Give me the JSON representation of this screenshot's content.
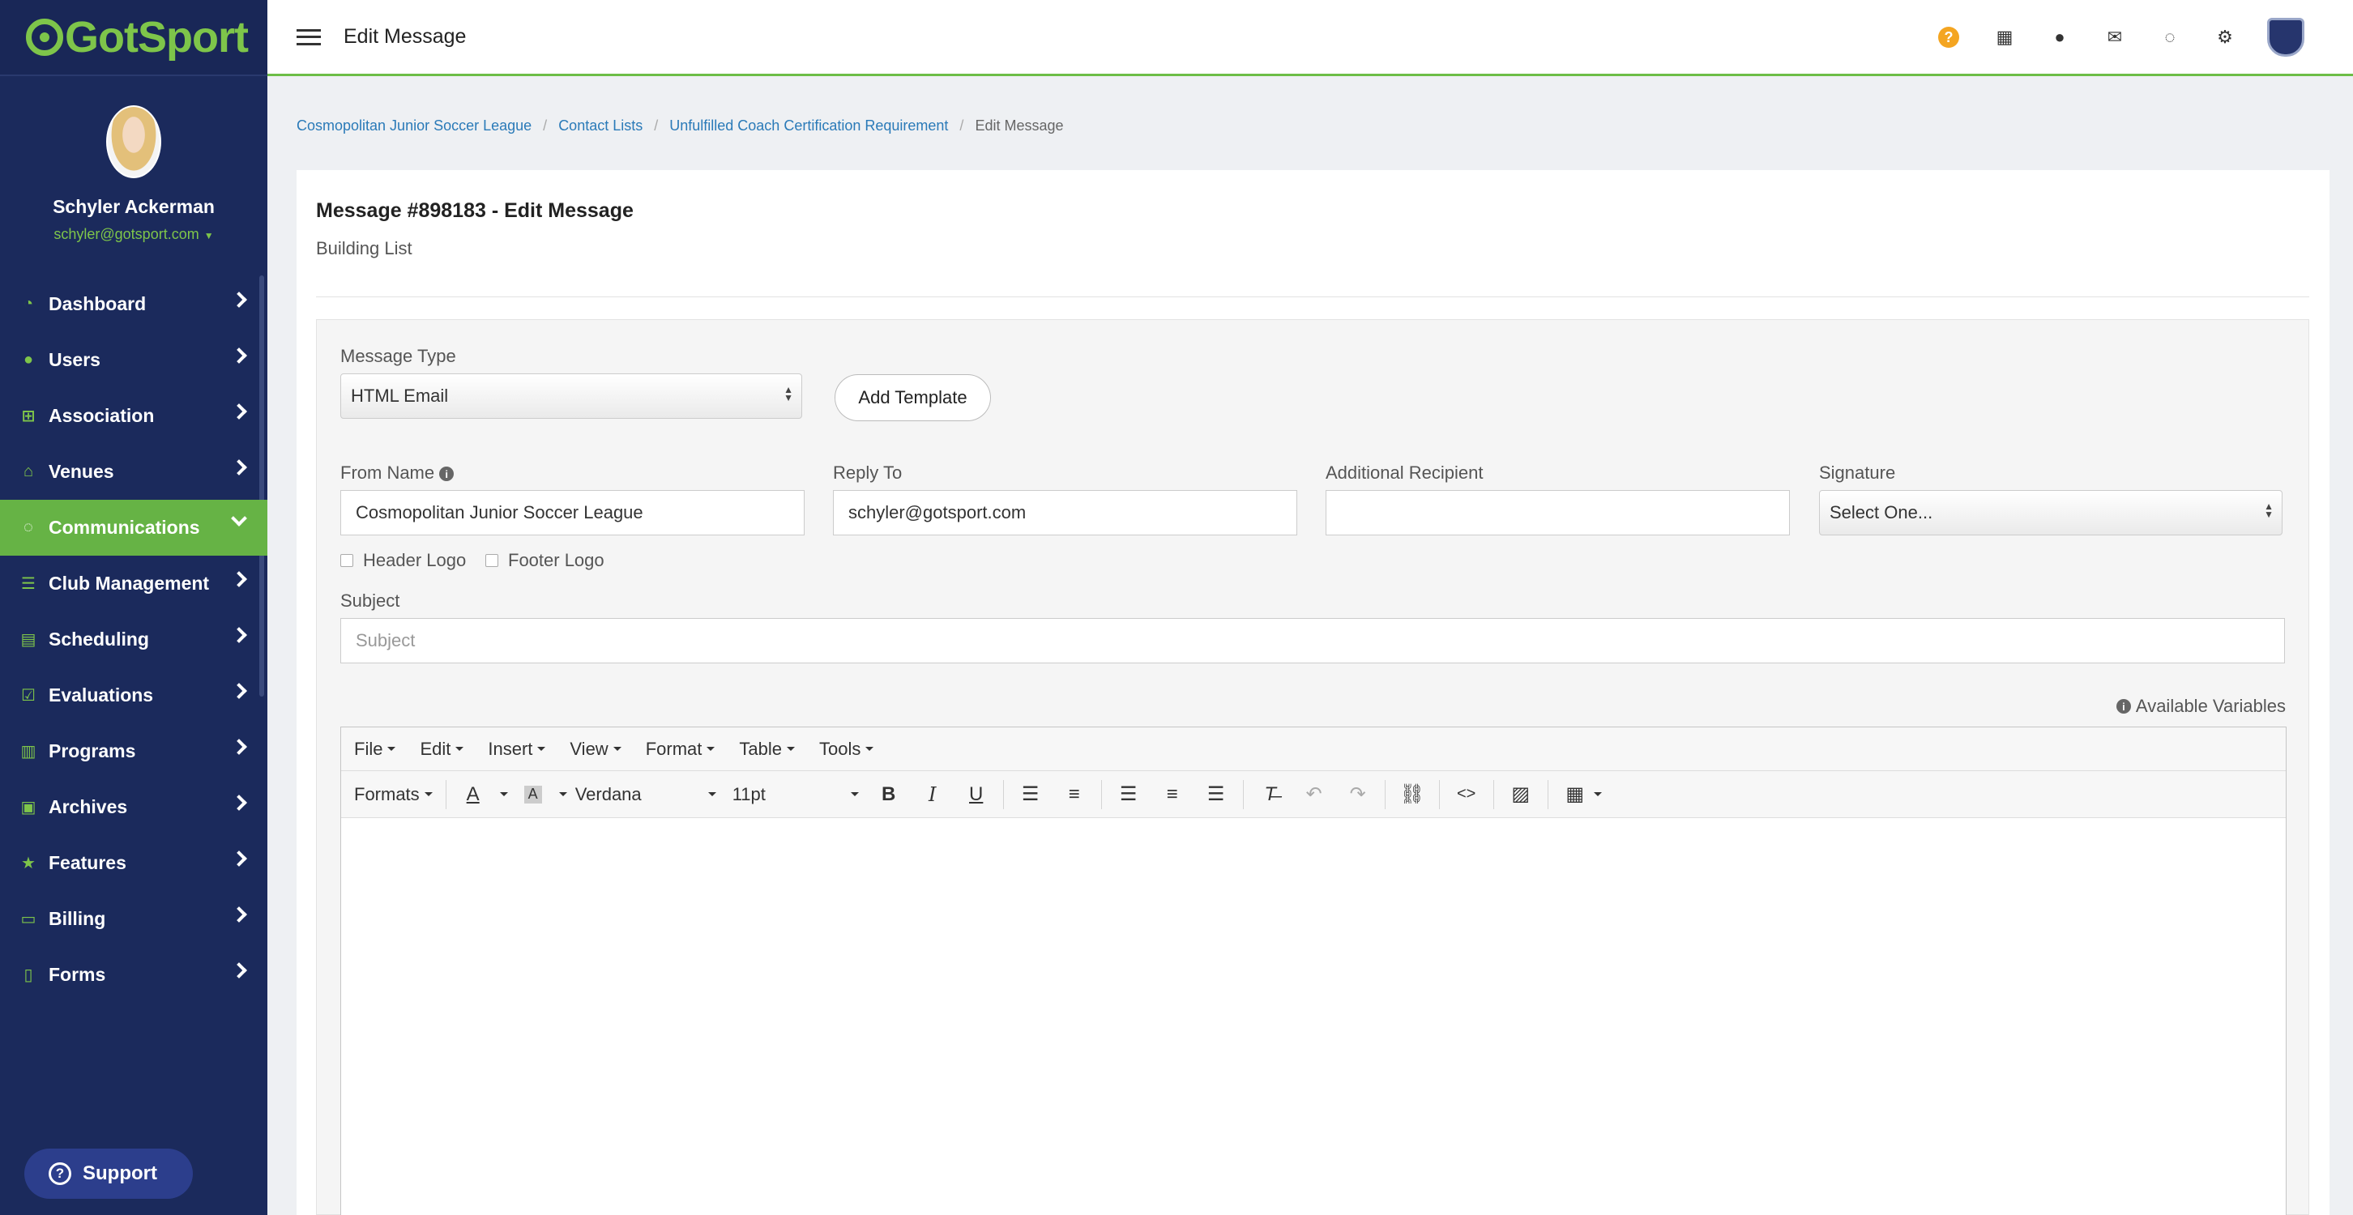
{
  "app": {
    "logo": "GotSport",
    "page_title": "Edit Message"
  },
  "user": {
    "name": "Schyler Ackerman",
    "email": "schyler@gotsport.com"
  },
  "nav": {
    "items": [
      {
        "label": "Dashboard",
        "icon": "dashboard-icon"
      },
      {
        "label": "Users",
        "icon": "users-icon"
      },
      {
        "label": "Association",
        "icon": "sitemap-icon"
      },
      {
        "label": "Venues",
        "icon": "home-icon"
      },
      {
        "label": "Communications",
        "icon": "chat-icon",
        "active": true
      },
      {
        "label": "Club Management",
        "icon": "list-icon"
      },
      {
        "label": "Scheduling",
        "icon": "schedule-icon"
      },
      {
        "label": "Evaluations",
        "icon": "calendar-check-icon"
      },
      {
        "label": "Programs",
        "icon": "book-icon"
      },
      {
        "label": "Archives",
        "icon": "archive-icon"
      },
      {
        "label": "Features",
        "icon": "star-icon"
      },
      {
        "label": "Billing",
        "icon": "credit-card-icon"
      },
      {
        "label": "Forms",
        "icon": "file-icon"
      }
    ],
    "support_label": "Support"
  },
  "breadcrumb": [
    "Cosmopolitan Junior Soccer League",
    "Contact Lists",
    "Unfulfilled Coach Certification Requirement",
    "Edit Message"
  ],
  "card": {
    "title": "Message #898183 - Edit Message",
    "subtitle": "Building List"
  },
  "form": {
    "message_type_label": "Message Type",
    "message_type_value": "HTML Email",
    "add_template_label": "Add Template",
    "from_name_label": "From Name",
    "from_name_value": "Cosmopolitan Junior Soccer League",
    "reply_to_label": "Reply To",
    "reply_to_value": "schyler@gotsport.com",
    "additional_recipient_label": "Additional Recipient",
    "additional_recipient_value": "",
    "signature_label": "Signature",
    "signature_value": "Select One...",
    "header_logo_label": "Header Logo",
    "footer_logo_label": "Footer Logo",
    "subject_label": "Subject",
    "subject_placeholder": "Subject",
    "available_variables_label": "Available Variables"
  },
  "editor": {
    "menus": [
      "File",
      "Edit",
      "Insert",
      "View",
      "Format",
      "Table",
      "Tools"
    ],
    "formats_label": "Formats",
    "font_family": "Verdana",
    "font_size": "11pt"
  }
}
